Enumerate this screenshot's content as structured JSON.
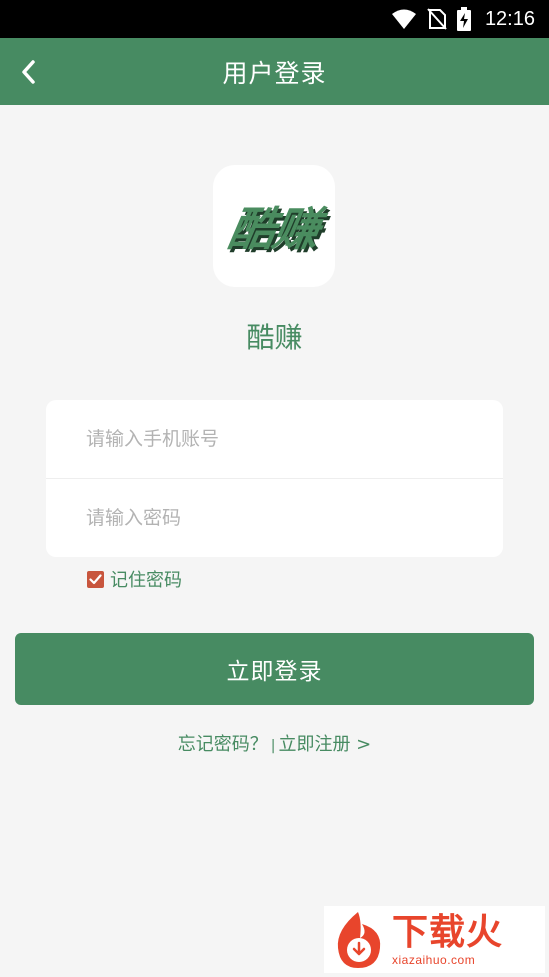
{
  "status_bar": {
    "time": "12:16",
    "icons": [
      "wifi-icon",
      "no-sim-icon",
      "battery-charging-icon"
    ]
  },
  "app_bar": {
    "title": "用户登录",
    "back_icon": "chevron-left-icon"
  },
  "logo": {
    "text": "酷赚"
  },
  "app_name": "酷赚",
  "form": {
    "phone_placeholder": "请输入手机账号",
    "password_placeholder": "请输入密码",
    "phone_value": "",
    "password_value": ""
  },
  "remember": {
    "label": "记住密码",
    "checked": true
  },
  "login_button": "立即登录",
  "links": {
    "forgot": "忘记密码？",
    "separator": "|",
    "register": "立即注册 >"
  },
  "watermark": {
    "main": "下载火",
    "sub": "xiazaihuo.com"
  },
  "colors": {
    "primary": "#478b62",
    "background": "#f5f5f5",
    "checkbox": "#c8553d",
    "watermark": "#e8452c"
  }
}
